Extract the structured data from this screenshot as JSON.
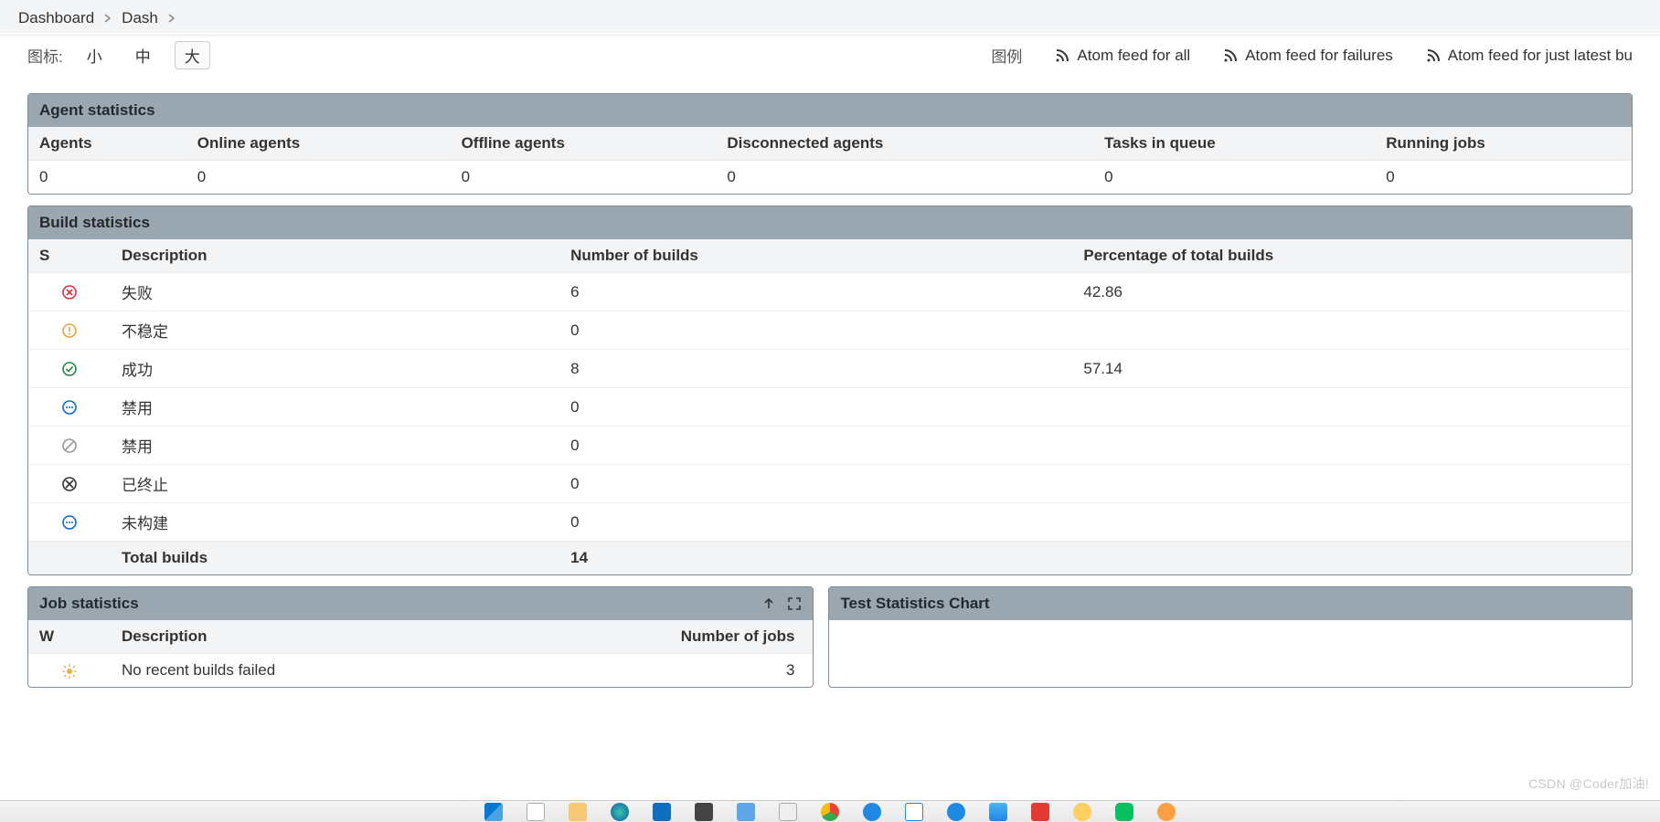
{
  "breadcrumb": {
    "item1": "Dashboard",
    "item2": "Dash"
  },
  "toolbar": {
    "icon_label": "图标:",
    "size_small": "小",
    "size_medium": "中",
    "size_large": "大",
    "legend_label": "图例",
    "feed_all": "Atom feed for all",
    "feed_failures": "Atom feed for failures",
    "feed_latest": "Atom feed for just latest bu"
  },
  "agent_stats": {
    "title": "Agent statistics",
    "headers": {
      "agents": "Agents",
      "online": "Online agents",
      "offline": "Offline agents",
      "disconnected": "Disconnected agents",
      "queue": "Tasks in queue",
      "running": "Running jobs"
    },
    "values": {
      "agents": "0",
      "online": "0",
      "offline": "0",
      "disconnected": "0",
      "queue": "0",
      "running": "0"
    }
  },
  "build_stats": {
    "title": "Build statistics",
    "headers": {
      "s": "S",
      "desc": "Description",
      "num": "Number of builds",
      "pct": "Percentage of total builds"
    },
    "rows": [
      {
        "desc": "失败",
        "num": "6",
        "pct": "42.86"
      },
      {
        "desc": "不稳定",
        "num": "0",
        "pct": ""
      },
      {
        "desc": "成功",
        "num": "8",
        "pct": "57.14"
      },
      {
        "desc": "禁用",
        "num": "0",
        "pct": ""
      },
      {
        "desc": "禁用",
        "num": "0",
        "pct": ""
      },
      {
        "desc": "已终止",
        "num": "0",
        "pct": ""
      },
      {
        "desc": "未构建",
        "num": "0",
        "pct": ""
      }
    ],
    "total": {
      "label": "Total builds",
      "value": "14"
    }
  },
  "job_stats": {
    "title": "Job statistics",
    "headers": {
      "w": "W",
      "desc": "Description",
      "num": "Number of jobs"
    },
    "rows": [
      {
        "desc": "No recent builds failed",
        "num": "3"
      }
    ]
  },
  "test_stats": {
    "title": "Test Statistics Chart"
  },
  "watermark": "CSDN @Coder加油!"
}
